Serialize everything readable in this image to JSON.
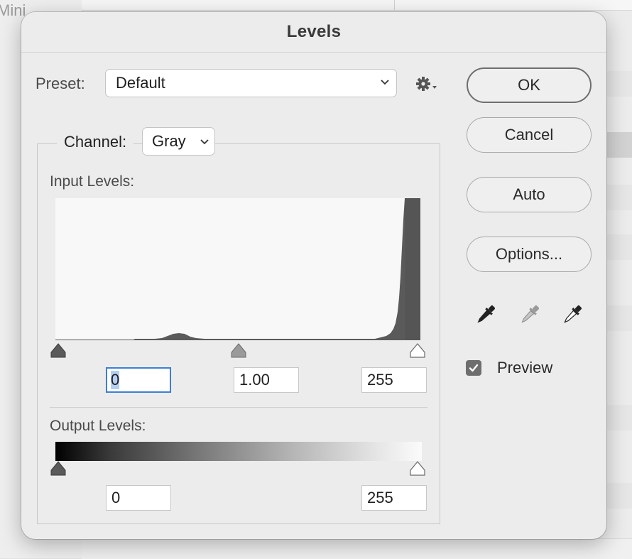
{
  "background": {
    "partial_text": "Mini"
  },
  "dialog": {
    "title": "Levels",
    "preset": {
      "label": "Preset:",
      "value": "Default"
    },
    "channel": {
      "label": "Channel:",
      "value": "Gray"
    },
    "input_levels": {
      "label": "Input Levels:",
      "black": "0",
      "gamma": "1.00",
      "white": "255"
    },
    "output_levels": {
      "label": "Output Levels:",
      "black": "0",
      "white": "255"
    },
    "buttons": {
      "ok": "OK",
      "cancel": "Cancel",
      "auto": "Auto",
      "options": "Options..."
    },
    "eyedroppers": [
      "black-point-eyedropper-icon",
      "gray-point-eyedropper-icon",
      "white-point-eyedropper-icon"
    ],
    "preview": {
      "label": "Preview",
      "checked": true
    }
  },
  "colors": {
    "dialog_bg": "#ececec",
    "focus_ring": "#3d7fd8",
    "histogram_fill": "#5a5a5a",
    "checkbox_fill": "#6e6e6e"
  }
}
